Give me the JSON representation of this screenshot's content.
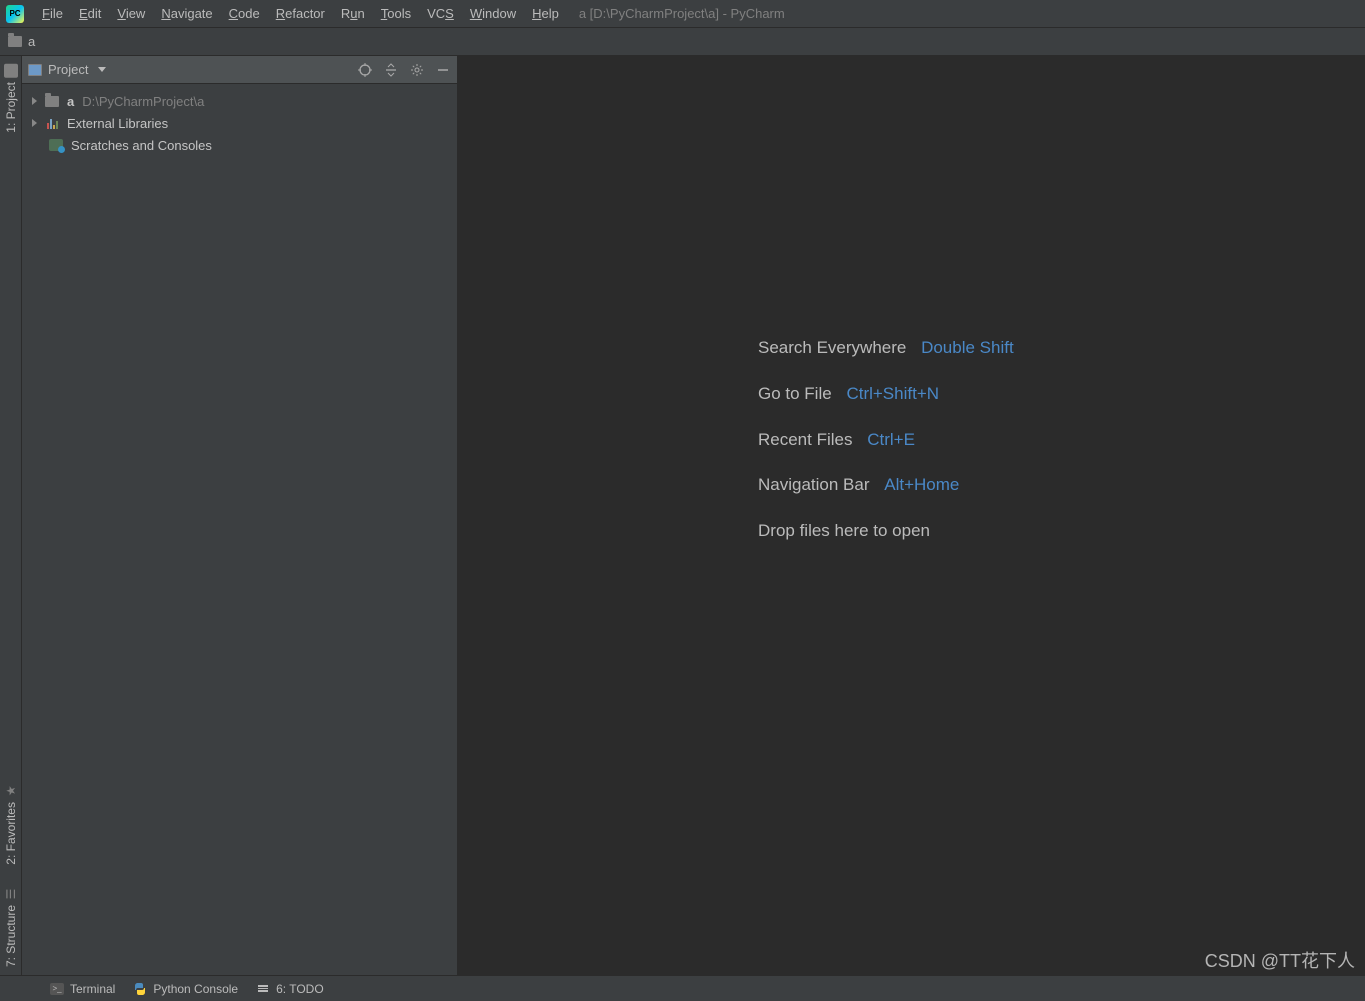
{
  "menubar": {
    "items": [
      {
        "label": "File",
        "u": "F"
      },
      {
        "label": "Edit",
        "u": "E"
      },
      {
        "label": "View",
        "u": "V"
      },
      {
        "label": "Navigate",
        "u": "N"
      },
      {
        "label": "Code",
        "u": "C"
      },
      {
        "label": "Refactor",
        "u": "R"
      },
      {
        "label": "Run",
        "u": "u"
      },
      {
        "label": "Tools",
        "u": "T"
      },
      {
        "label": "VCS",
        "u": "S"
      },
      {
        "label": "Window",
        "u": "W"
      },
      {
        "label": "Help",
        "u": "H"
      }
    ],
    "title": "a [D:\\PyCharmProject\\a] - PyCharm"
  },
  "breadcrumb": {
    "label": "a"
  },
  "left_tabs": {
    "project": "1: Project",
    "favorites": "2: Favorites",
    "structure": "7: Structure"
  },
  "project_panel": {
    "title": "Project",
    "tree": {
      "root_name": "a",
      "root_path": "D:\\PyCharmProject\\a",
      "external_libs": "External Libraries",
      "scratches": "Scratches and Consoles"
    }
  },
  "hints": {
    "search_label": "Search Everywhere",
    "search_key": "Double Shift",
    "goto_label": "Go to File",
    "goto_key": "Ctrl+Shift+N",
    "recent_label": "Recent Files",
    "recent_key": "Ctrl+E",
    "nav_label": "Navigation Bar",
    "nav_key": "Alt+Home",
    "drop_label": "Drop files here to open"
  },
  "bottombar": {
    "terminal": "Terminal",
    "python_console": "Python Console",
    "todo": "6: TODO"
  },
  "watermark": "CSDN @TT花下人"
}
